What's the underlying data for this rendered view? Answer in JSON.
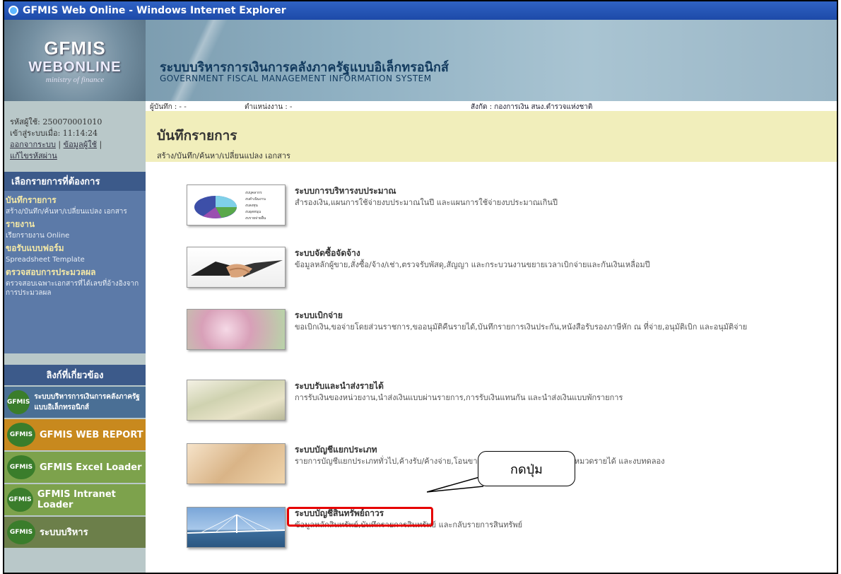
{
  "window": {
    "title": "GFMIS Web Online - Windows Internet Explorer"
  },
  "logo": {
    "line1": "GFMIS",
    "line2": "WEBONLINE",
    "line3": "ministry of finance"
  },
  "banner": {
    "title_th": "ระบบบริหารการเงินการคลังภาครัฐแบบอิเล็กทรอนิกส์",
    "title_en": "GOVERNMENT FISCAL MANAGEMENT INFORMATION SYSTEM"
  },
  "infobar": {
    "recorder": "ผู้บันทึก : - -",
    "position": "ตำแหน่งงาน : -",
    "affiliation": "สังกัด  : กองการเงิน สนง.ตำรวจแห่งชาติ"
  },
  "user": {
    "id_line": "รหัสผู้ใช้: 250070001010",
    "login_line": "เข้าสู่ระบบเมื่อ: 11:14:24",
    "logout": "ออกจากระบบ",
    "userinfo": "ข้อมูลผู้ใช้",
    "change_password": "แก้ไขรหัสผ่าน"
  },
  "sidebar": {
    "menu_header": "เลือกรายการที่ต้องการ",
    "menu": [
      {
        "label": "บันทึกรายการ",
        "sub": "สร้าง/บันทึก/ค้นหา/เปลี่ยนแปลง เอกสาร"
      },
      {
        "label": "รายงาน",
        "sub": "เรียกรายงาน Online"
      },
      {
        "label": "ขอรับแบบฟอร์ม",
        "sub": "Spreadsheet Template"
      },
      {
        "label": "ตรวจสอบการประมวลผล",
        "sub": "ตรวจสอบเฉพาะเอกสารที่ได้เลขที่อ้างอิงจากการประมวลผล"
      }
    ],
    "links_header": "ลิงก์ที่เกี่ยวข้อง",
    "links": [
      {
        "badge": "GFMIS",
        "text": "ระบบบริหารการเงินการคลังภาครัฐแบบอิเล็กทรอนิกส์",
        "color": "#4a6f95"
      },
      {
        "badge": "GFMIS",
        "text": "GFMIS WEB REPORT",
        "color": "#c8891e"
      },
      {
        "badge": "GFMIS",
        "text": "GFMIS Excel Loader",
        "color": "#7da24c"
      },
      {
        "badge": "GFMIS",
        "text": "GFMIS Intranet Loader",
        "color": "#7da24c"
      },
      {
        "badge": "GFMIS",
        "text": "ระบบบริหาร",
        "color": "#6c7f4a"
      }
    ]
  },
  "page": {
    "title": "บันทึกรายการ",
    "subtitle": "สร้าง/บันทึก/ค้นหา/เปลี่ยนแปลง เอกสาร"
  },
  "modules": [
    {
      "title": "ระบบการบริหารงบประมาณ",
      "desc": "สำรองเงิน,แผนการใช้จ่ายงบประมาณในปี และแผนการใช้จ่ายงบประมาณเกินปี"
    },
    {
      "title": "ระบบจัดซื้อจัดจ้าง",
      "desc": "ข้อมูลหลักผู้ขาย,สั่งซื้อ/จ้าง/เช่า,ตรวจรับพัสดุ,สัญญา และกระบวนงานขยายเวลาเบิกจ่ายและกันเงินเหลื่อมปี"
    },
    {
      "title": "ระบบเบิกจ่าย",
      "desc": "ขอเบิกเงิน,ขอจ่ายโดยส่วนราชการ,ขออนุมัติคืนรายได้,บันทึกรายการเงินประกัน,หนังสือรับรองภาษีหัก ณ ที่จ่าย,อนุมัติเบิก และอนุมัติจ่าย"
    },
    {
      "title": "ระบบรับและนำส่งรายได้",
      "desc": "การรับเงินของหน่วยงาน,นำส่งเงินแบบผ่านรายการ,การรับเงินแทนกัน และนำส่งเงินแบบพักรายการ"
    },
    {
      "title": "ระบบบัญชีแยกประเภท",
      "desc": "รายการบัญชีแยกประเภททั่วไป,ค้างรับ/ค้างจ่าย,โอนขายบัญชีสั่ง พักเอกสาร,ปรับปรุงหมวดรายได้ และงบทดลอง"
    },
    {
      "title": "ระบบบัญชีสินทรัพย์ถาวร",
      "desc": "ข้อมูลหลักสินทรัพย์,บันทึกรายการสินทรัพย์ และกลับรายการสินทรัพย์"
    }
  ],
  "callout": {
    "text": "กดปุ่ม"
  },
  "pie_legend": [
    "งบบุคลากร",
    "งบดำเนินงาน",
    "งบลงทุน",
    "งบอุดหนุน",
    "งบรายจ่ายอื่น"
  ]
}
